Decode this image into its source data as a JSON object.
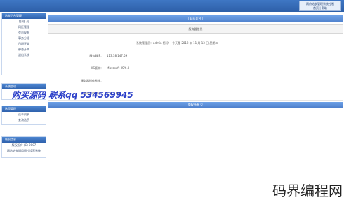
{
  "top": {
    "right_title": "网府站长管理系统控制",
    "right_links": "首页 | 帮助"
  },
  "sidebar": {
    "sections": [
      {
        "title": "站长后台管理",
        "items": [
          "管 理 员",
          "网区管理",
          "会员权限",
          "事务分组",
          "日期开关",
          "静态开关",
          "退出系统"
        ]
      },
      {
        "title": "系统管理",
        "items": []
      },
      {
        "title": "选项管理",
        "items": [
          "选手列表",
          "查询选手"
        ]
      },
      {
        "title": "版权信息",
        "items": [
          "版权所有 (C) 2007",
          "网站站长通用图片设置系统"
        ]
      }
    ]
  },
  "main": {
    "header": "| 站长后台 |",
    "panel_title": "服务器信息",
    "rows": [
      {
        "label": "",
        "value": "系统管理员：admin 您好！ 今天是 2012 年 11 月 13 日 星期二"
      },
      {
        "label": "服务器IP：",
        "value": "113.38.147.59"
      },
      {
        "label": "IIS版本：",
        "value": "Microsoft-IIS/6.0"
      },
      {
        "label": "服务器操作系统：",
        "value": ""
      },
      {
        "label": "网站占用空间：",
        "value": "1.112 MB"
      }
    ],
    "footer": "版权所有 ©"
  },
  "watermark": "购买源码 联系qq 534569945",
  "bottom_brand": "码界编程网"
}
